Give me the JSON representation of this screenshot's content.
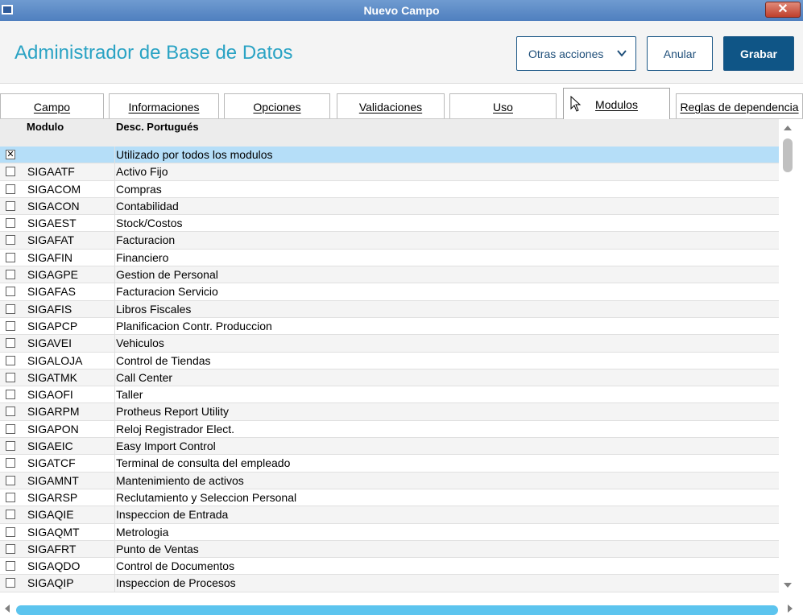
{
  "window": {
    "title": "Nuevo Campo",
    "close_label": "✕"
  },
  "header": {
    "title": "Administrador de Base de Datos",
    "other_actions_label": "Otras acciones",
    "cancel_label": "Anular",
    "save_label": "Grabar"
  },
  "tabs": [
    {
      "label": "Campo"
    },
    {
      "label": "Informaciones"
    },
    {
      "label": "Opciones"
    },
    {
      "label": "Validaciones"
    },
    {
      "label": "Uso"
    },
    {
      "label": "Modulos",
      "active": true
    },
    {
      "label": "Reglas de dependencia"
    }
  ],
  "grid": {
    "columns": [
      "Modulo",
      "Desc. Portugués"
    ],
    "rows": [
      {
        "checked": true,
        "code": "",
        "desc": "Utilizado por todos los modulos",
        "selected": true
      },
      {
        "checked": false,
        "code": "SIGAATF",
        "desc": "Activo Fijo"
      },
      {
        "checked": false,
        "code": "SIGACOM",
        "desc": "Compras"
      },
      {
        "checked": false,
        "code": "SIGACON",
        "desc": "Contabilidad"
      },
      {
        "checked": false,
        "code": "SIGAEST",
        "desc": "Stock/Costos"
      },
      {
        "checked": false,
        "code": "SIGAFAT",
        "desc": "Facturacion"
      },
      {
        "checked": false,
        "code": "SIGAFIN",
        "desc": "Financiero"
      },
      {
        "checked": false,
        "code": "SIGAGPE",
        "desc": "Gestion de Personal"
      },
      {
        "checked": false,
        "code": "SIGAFAS",
        "desc": "Facturacion Servicio"
      },
      {
        "checked": false,
        "code": "SIGAFIS",
        "desc": "Libros Fiscales"
      },
      {
        "checked": false,
        "code": "SIGAPCP",
        "desc": "Planificacion Contr. Produccion"
      },
      {
        "checked": false,
        "code": "SIGAVEI",
        "desc": "Vehiculos"
      },
      {
        "checked": false,
        "code": "SIGALOJA",
        "desc": "Control de Tiendas"
      },
      {
        "checked": false,
        "code": "SIGATMK",
        "desc": "Call Center"
      },
      {
        "checked": false,
        "code": "SIGAOFI",
        "desc": "Taller"
      },
      {
        "checked": false,
        "code": "SIGARPM",
        "desc": "Protheus Report Utility"
      },
      {
        "checked": false,
        "code": "SIGAPON",
        "desc": "Reloj Registrador Elect."
      },
      {
        "checked": false,
        "code": "SIGAEIC",
        "desc": "Easy Import Control"
      },
      {
        "checked": false,
        "code": "SIGATCF",
        "desc": "Terminal de consulta del empleado"
      },
      {
        "checked": false,
        "code": "SIGAMNT",
        "desc": "Mantenimiento de activos"
      },
      {
        "checked": false,
        "code": "SIGARSP",
        "desc": "Reclutamiento y Seleccion Personal"
      },
      {
        "checked": false,
        "code": "SIGAQIE",
        "desc": "Inspeccion de Entrada"
      },
      {
        "checked": false,
        "code": "SIGAQMT",
        "desc": "Metrologia"
      },
      {
        "checked": false,
        "code": "SIGAFRT",
        "desc": "Punto de Ventas"
      },
      {
        "checked": false,
        "code": "SIGAQDO",
        "desc": "Control de Documentos"
      },
      {
        "checked": false,
        "code": "SIGAQIP",
        "desc": "Inspeccion de Procesos"
      }
    ]
  },
  "colors": {
    "accent": "#2aa3c4",
    "primary_button": "#0f5586",
    "selection": "#b5def8",
    "scroll_thumb": "#5cc4ee"
  },
  "icons": {
    "cursor": "pointer-cursor-icon",
    "chevron": "chevron-down-icon"
  }
}
